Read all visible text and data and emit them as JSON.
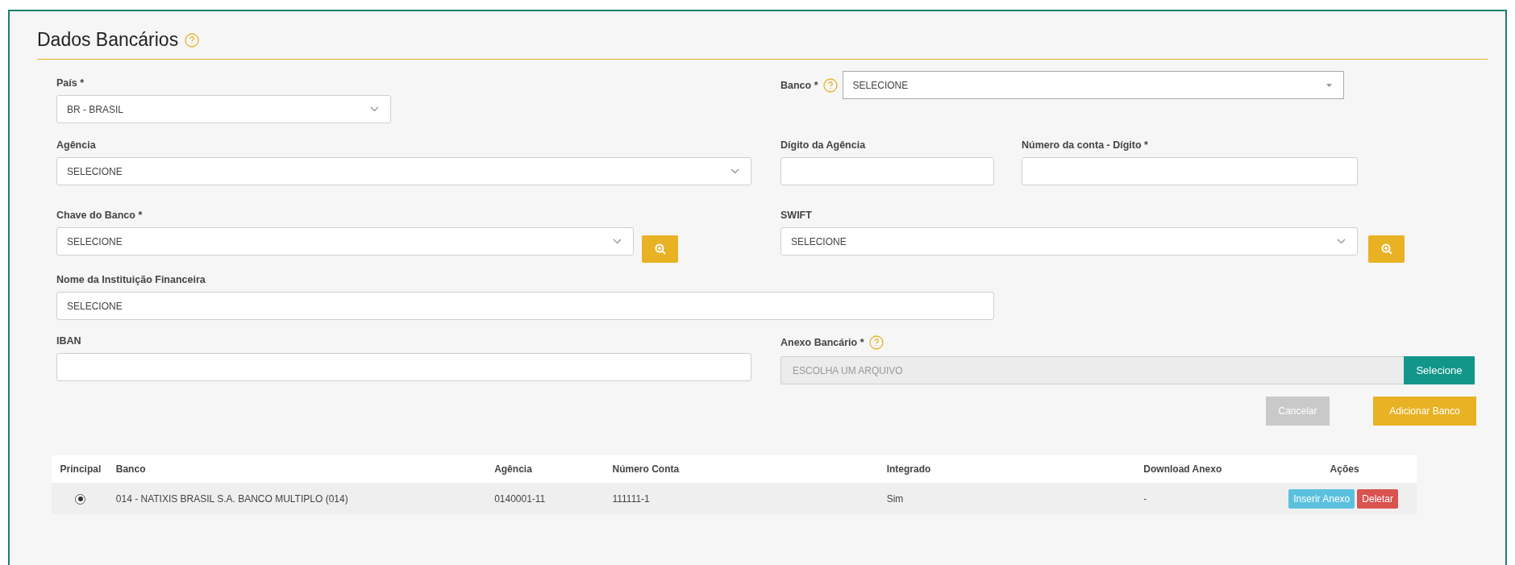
{
  "section": {
    "title": "Dados Bancários"
  },
  "fields": {
    "pais": {
      "label": "País *",
      "kind": "select",
      "value": "BR - BRASIL"
    },
    "banco": {
      "label": "Banco *",
      "kind": "combo",
      "value": "SELECIONE"
    },
    "agencia": {
      "label": "Agência",
      "kind": "select",
      "value": "SELECIONE"
    },
    "digito_agencia": {
      "label": "Dígito da Agência",
      "kind": "input"
    },
    "numero_conta": {
      "label": "Número da conta - Dígito *",
      "kind": "input"
    },
    "chave_banco": {
      "label": "Chave do Banco *",
      "kind": "select",
      "value": "SELECIONE"
    },
    "swift": {
      "label": "SWIFT",
      "kind": "select",
      "value": "SELECIONE"
    },
    "nome_instituicao": {
      "label": "Nome da Instituição Financeira",
      "kind": "input",
      "value": "SELECIONE"
    },
    "iban": {
      "label": "IBAN",
      "kind": "input"
    },
    "anexo": {
      "label": "Anexo Bancário *",
      "kind": "file",
      "placeholder": "ESCOLHA UM ARQUIVO",
      "button": "Selecione"
    }
  },
  "buttons": [
    {
      "label": "Cancelar",
      "disabled": true
    },
    {
      "label": "Adicionar Banco",
      "disabled": false
    }
  ],
  "table": {
    "columns": [
      "Principal",
      "Banco",
      "Agência",
      "Número Conta",
      "Integrado",
      "Download Anexo",
      "Ações"
    ],
    "rows": [
      {
        "selected": true,
        "banco": "014 - NATIXIS BRASIL S.A. BANCO MULTIPLO (014)",
        "agencia": "0140001-11",
        "numero_conta": "111111-1",
        "integrado": "Sim",
        "download": "-",
        "actions": [
          {
            "kind": "info",
            "label": "Inserir Anexo"
          },
          {
            "kind": "danger",
            "label": "Deletar"
          }
        ]
      }
    ]
  }
}
